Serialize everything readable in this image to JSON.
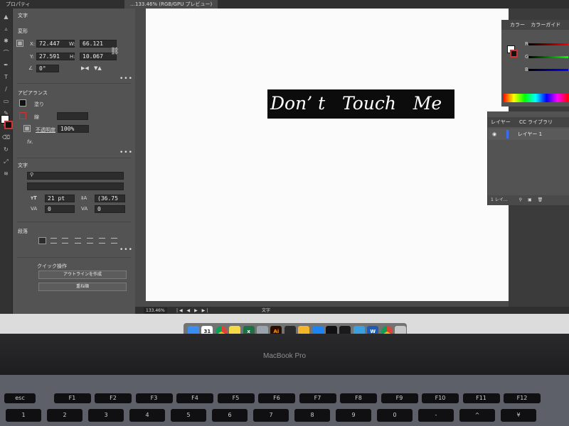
{
  "window": {
    "doc_tab": "…133.46% (RGB/GPU プレビュー)",
    "panel_tab": "プロパティ"
  },
  "toolbar": {
    "icons": [
      "selection-tool-icon",
      "direct-selection-icon",
      "magic-wand-icon",
      "lasso-icon",
      "pen-tool-icon",
      "type-tool-icon",
      "line-tool-icon",
      "rectangle-tool-icon",
      "paintbrush-icon",
      "pencil-icon",
      "eraser-icon",
      "rotate-icon",
      "scale-icon",
      "width-icon",
      "free-transform-icon",
      "shape-builder-icon",
      "perspective-icon",
      "mesh-icon",
      "gradient-icon",
      "eyedropper-icon",
      "blend-icon",
      "symbol-sprayer-icon",
      "graph-icon",
      "artboard-icon",
      "slice-icon",
      "hand-icon",
      "zoom-icon"
    ]
  },
  "properties": {
    "type_label": "文字",
    "transform": {
      "title": "変形",
      "x_label": "X:",
      "x": "72.447",
      "y_label": "Y:",
      "y": "27.591",
      "w_label": "W:",
      "w": "66.121",
      "h_label": "H:",
      "h": "10.067",
      "angle": "0°"
    },
    "appearance": {
      "title": "アピアランス",
      "fill_label": "塗り",
      "stroke_label": "線",
      "opacity_label": "不透明度",
      "opacity": "100%",
      "fx": "fx."
    },
    "character": {
      "title": "文字",
      "font_size": "21 pt",
      "leading": "(36.75",
      "tracking": "0",
      "kerning": "0"
    },
    "paragraph": {
      "title": "段落"
    },
    "quick_actions": {
      "title": "クイック操作",
      "outline_button": "アウトラインを作成",
      "arrange_button": "重ね順"
    },
    "more": "•••"
  },
  "canvas": {
    "art_text": "Don’ t   Touch   Me"
  },
  "statusbar": {
    "zoom": "133.46%",
    "mode": "文字",
    "nav": "|◀ ◀ ▶ ▶|"
  },
  "color_panel": {
    "tab_color": "カラー",
    "tab_guide": "カラーガイド",
    "channels": [
      "R",
      "G",
      "B"
    ]
  },
  "layers_panel": {
    "tab_layers": "レイヤー",
    "tab_cc": "CC ライブラリ",
    "layer_name": "レイヤー 1",
    "count": "1 レイ…"
  },
  "dock": {
    "apps": [
      "finder",
      "calendar",
      "chrome",
      "notes",
      "excel",
      "mail",
      "illustrator",
      "photo",
      "fontbook",
      "safari",
      "sketch",
      "terminal",
      "preview",
      "word",
      "chrome",
      "trash"
    ],
    "calendar_day": "31",
    "ai_label": "Ai",
    "word_label": "W",
    "excel_label": "x"
  },
  "laptop": {
    "brand": "MacBook Pro"
  },
  "keyboard": {
    "fn_row": [
      "esc",
      "F1",
      "F2",
      "F3",
      "F4",
      "F5",
      "F6",
      "F7",
      "F8",
      "F9",
      "F10",
      "F11",
      "F12"
    ],
    "num_row": [
      "1",
      "2",
      "3",
      "4",
      "5",
      "6",
      "7",
      "8",
      "9",
      "0",
      "-",
      "^",
      "¥"
    ]
  }
}
